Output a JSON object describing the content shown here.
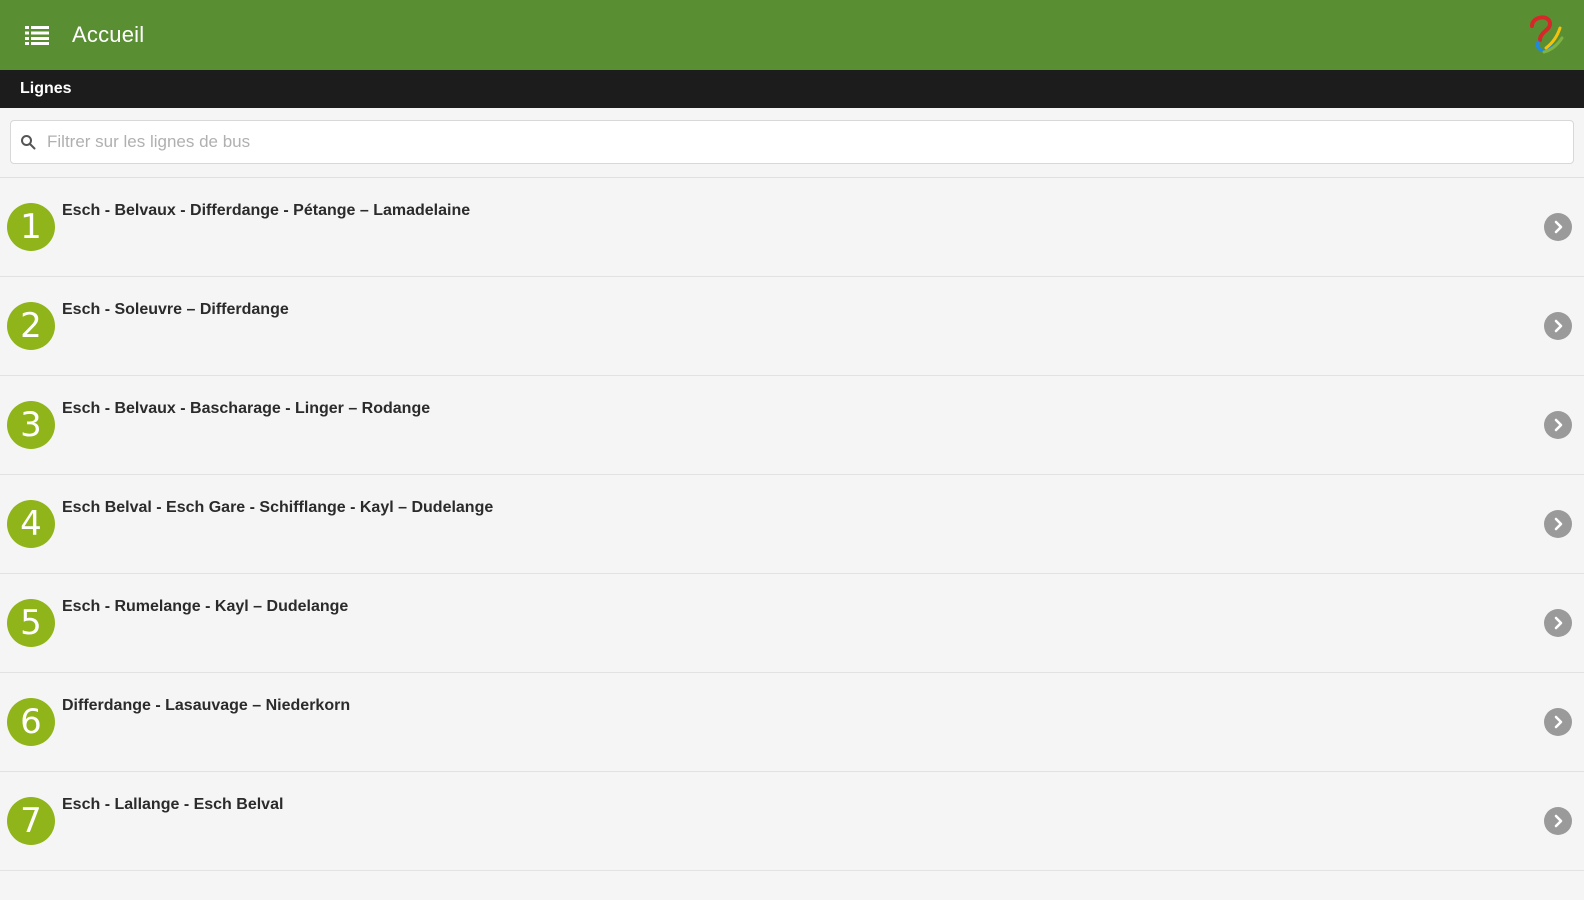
{
  "appbar": {
    "title": "Accueil",
    "menu_icon": "menu-list-icon",
    "logo_icon": "app-logo-icon",
    "color": "#5a8e33"
  },
  "section": {
    "title": "Lignes"
  },
  "search": {
    "placeholder": "Filtrer sur les lignes de bus",
    "value": ""
  },
  "lines": [
    {
      "number": "1",
      "name": "Esch - Belvaux - Differdange - Pétange – Lamadelaine"
    },
    {
      "number": "2",
      "name": "Esch - Soleuvre – Differdange"
    },
    {
      "number": "3",
      "name": "Esch - Belvaux - Bascharage - Linger – Rodange"
    },
    {
      "number": "4",
      "name": "Esch Belval - Esch Gare - Schifflange - Kayl – Dudelange"
    },
    {
      "number": "5",
      "name": "Esch - Rumelange - Kayl – Dudelange"
    },
    {
      "number": "6",
      "name": "Differdange - Lasauvage – Niederkorn"
    },
    {
      "number": "7",
      "name": "Esch - Lallange - Esch Belval"
    }
  ],
  "badge_color": "#8fb51a"
}
